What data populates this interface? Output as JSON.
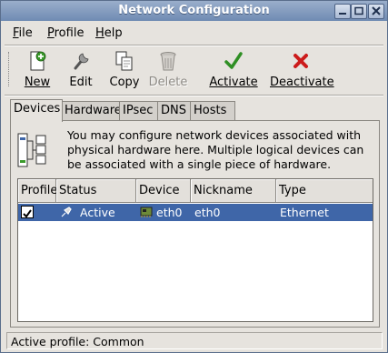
{
  "window": {
    "title": "Network Configuration"
  },
  "menubar": [
    {
      "key": "F",
      "rest": "ile"
    },
    {
      "key": "P",
      "rest": "rofile"
    },
    {
      "key": "H",
      "rest": "elp"
    }
  ],
  "toolbar": {
    "new": "New",
    "edit": "Edit",
    "copy": "Copy",
    "delete": "Delete",
    "activate": "Activate",
    "deactivate": "Deactivate"
  },
  "tabs": [
    "Devices",
    "Hardware",
    "IPsec",
    "DNS",
    "Hosts"
  ],
  "info": "You may configure network devices associated with physical hardware here.  Multiple logical devices can be associated with a single piece of hardware.",
  "table": {
    "columns": [
      "Profile",
      "Status",
      "Device",
      "Nickname",
      "Type"
    ],
    "rows": [
      {
        "profile": true,
        "status": "Active",
        "device": "eth0",
        "nickname": "eth0",
        "type": "Ethernet"
      }
    ]
  },
  "status_bar": "Active profile: Common",
  "colors": {
    "selection": "#3f66a8",
    "titlebar": "#7a93b9"
  }
}
